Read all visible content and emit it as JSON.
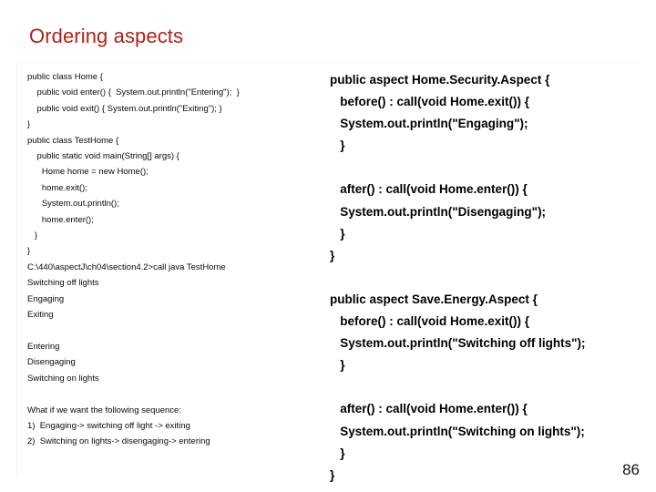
{
  "slide": {
    "title": "Ordering aspects",
    "page_number": "86",
    "title_color": "#B32017",
    "background_color": "#ffffff",
    "text_color": "#0a0a0a"
  },
  "left_column": {
    "lines": [
      "public class Home {",
      "    public void enter() {  System.out.println(\"Entering\");  }",
      "    public void exit() { System.out.println(\"Exiting\"); }",
      "}",
      "public class TestHome {",
      "    public static void main(String[] args) {",
      "      Home home = new Home();",
      "      home.exit();",
      "      System.out.println();",
      "      home.enter();",
      "   }",
      "}",
      "C:\\440\\aspectJ\\ch04\\section4.2>call java TestHome",
      "Switching off lights",
      "Engaging",
      "Exiting",
      "",
      "Entering",
      "Disengaging",
      "Switching on lights",
      "",
      "What if we want the following sequence:",
      "1)  Engaging-> switching off light -> exiting",
      "2)  Switching on lights-> disengaging-> entering"
    ]
  },
  "right_column": {
    "lines": [
      "public aspect Home.Security.Aspect {",
      "   before() : call(void Home.exit()) {",
      "   System.out.println(\"Engaging\");",
      "   }",
      "",
      "   after() : call(void Home.enter()) {",
      "   System.out.println(\"Disengaging\");",
      "   }",
      "}",
      "",
      "public aspect Save.Energy.Aspect {",
      "   before() : call(void Home.exit()) {",
      "   System.out.println(\"Switching off lights\");",
      "   }",
      "",
      "   after() : call(void Home.enter()) {",
      "   System.out.println(\"Switching on lights\");",
      "   }",
      "}"
    ]
  }
}
